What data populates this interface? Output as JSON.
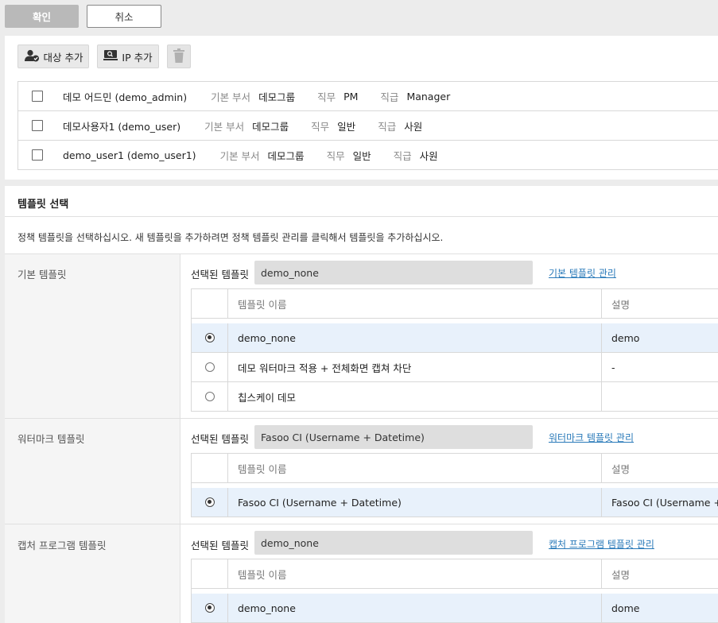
{
  "top_buttons": {
    "confirm": "확인",
    "cancel": "취소"
  },
  "toolbar": {
    "add_target": "대상 추가",
    "add_ip": "IP 추가"
  },
  "targets": [
    {
      "name": "데모 어드민 (demo_admin)",
      "dept_label": "기본 부서",
      "dept": "데모그룹",
      "duty_label": "직무",
      "duty": "PM",
      "rank_label": "직급",
      "rank": "Manager"
    },
    {
      "name": "데모사용자1 (demo_user)",
      "dept_label": "기본 부서",
      "dept": "데모그룹",
      "duty_label": "직무",
      "duty": "일반",
      "rank_label": "직급",
      "rank": "사원"
    },
    {
      "name": "demo_user1 (demo_user1)",
      "dept_label": "기본 부서",
      "dept": "데모그룹",
      "duty_label": "직무",
      "duty": "일반",
      "rank_label": "직급",
      "rank": "사원"
    }
  ],
  "template_section": {
    "title": "템플릿 선택",
    "description": "정책 템플릿을 선택하십시오. 새 템플릿을 추가하려면 정책 템플릿 관리를 클릭해서 템플릿을 추가하십시오.",
    "selected_label": "선택된 템플릿",
    "col_name": "템플릿 이름",
    "col_desc": "설명"
  },
  "basic": {
    "category": "기본 템플릿",
    "selected": "demo_none",
    "manage": "기본 템플릿 관리",
    "rows": [
      {
        "name": "demo_none",
        "desc": "demo",
        "checked": true
      },
      {
        "name": "데모 워터마크 적용 + 전체화면 캡쳐 차단",
        "desc": "-",
        "checked": false
      },
      {
        "name": "칩스케이 데모",
        "desc": "",
        "checked": false
      }
    ]
  },
  "watermark": {
    "category": "워터마크 템플릿",
    "selected": "Fasoo CI (Username + Datetime)",
    "manage": "워터마크 템플릿 관리",
    "rows": [
      {
        "name": "Fasoo CI (Username + Datetime)",
        "desc": "Fasoo CI (Username + Datetime)",
        "checked": true
      }
    ]
  },
  "capture": {
    "category": "캡처 프로그램 템플릿",
    "selected": "demo_none",
    "manage": "캡처 프로그램 템플릿 관리",
    "rows": [
      {
        "name": "demo_none",
        "desc": "dome",
        "checked": true
      }
    ]
  },
  "colors": {
    "selected_row": "#e8f1fb",
    "link": "#2a7ab9",
    "confirm_disabled": "#b9b9b9"
  }
}
